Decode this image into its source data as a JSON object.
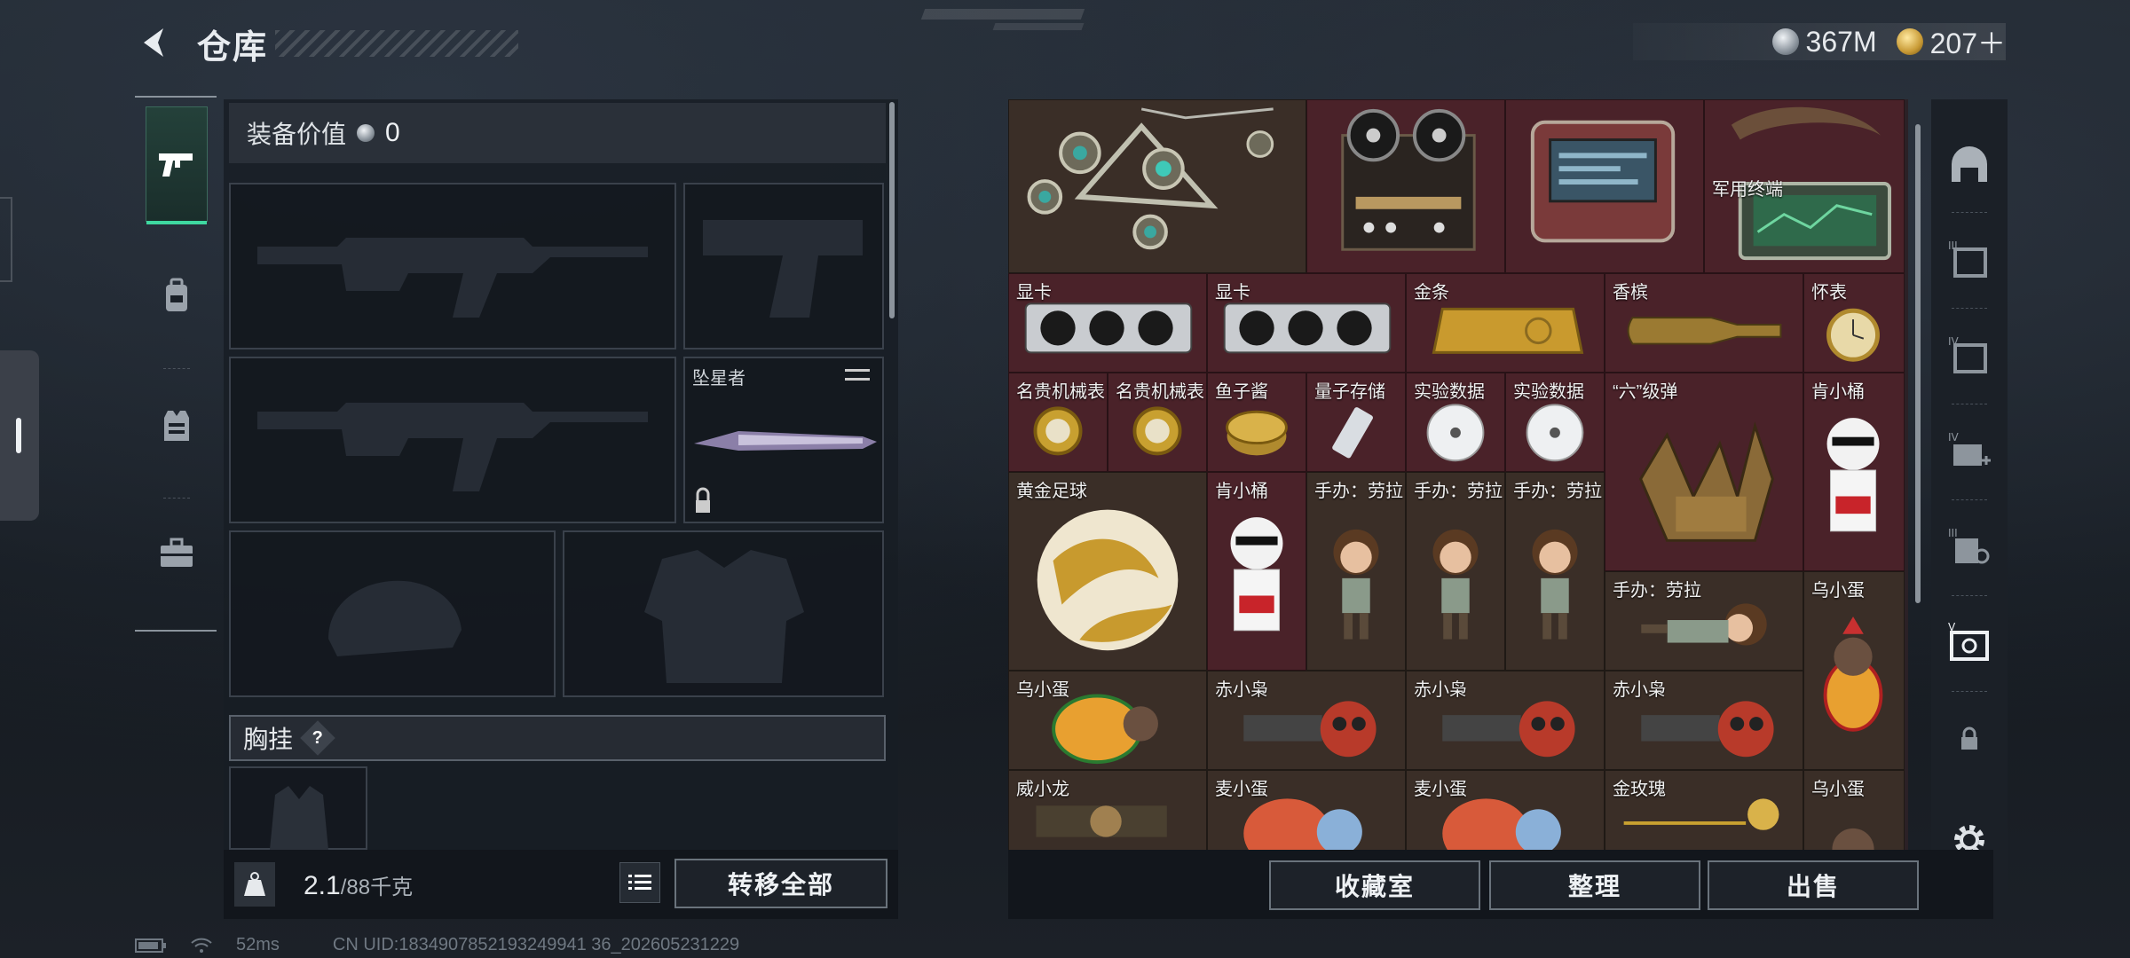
{
  "header": {
    "title": "仓库",
    "currency": [
      {
        "icon": "silver-coin-icon",
        "value": "367M"
      },
      {
        "icon": "gold-coin-icon",
        "value": "207＋"
      }
    ]
  },
  "left_tabs": [
    "pistol-icon",
    "backpack-icon",
    "vest-icon",
    "toolbox-icon"
  ],
  "equipment": {
    "value_label": "装备价值",
    "value": "0",
    "melee_label": "坠星者",
    "chest_label": "胸挂",
    "chest_help": "?",
    "weight": "2.1",
    "weight_max": "/88千克",
    "transfer_all": "转移全部"
  },
  "items": {
    "r2": [
      "显卡",
      "显卡",
      "金条",
      "香槟",
      "怀表"
    ],
    "r3": [
      "名贵机械表",
      "名贵机械表",
      "鱼子酱",
      "量子存储",
      "实验数据",
      "实验数据",
      "“六”级弹",
      "肯小桶"
    ],
    "r4": [
      "黄金足球",
      "肯小桶",
      "手办：劳拉",
      "手办：劳拉",
      "手办：劳拉"
    ],
    "r5": [
      "手办：劳拉",
      "乌小蛋"
    ],
    "r6": [
      "乌小蛋",
      "赤小枭",
      "赤小枭",
      "赤小枭"
    ],
    "r7": [
      "威小龙",
      "麦小蛋",
      "麦小蛋",
      "金玫瑰",
      "乌小蛋"
    ],
    "military": "军用终端"
  },
  "actions": {
    "collection": "收藏室",
    "sort": "整理",
    "sell": "出售"
  },
  "right_tools": [
    "home-icon",
    "tier3-case-icon",
    "tier4-case-icon",
    "tier4-medkit-icon",
    "tier3-armor-icon",
    "vip-case-icon",
    "lock-icon",
    "settings-icon"
  ],
  "status": {
    "ping": "52ms",
    "uid": "CN UID:1834907852193249941 36_202605231229"
  },
  "colors": {
    "accent": "#3fd8a0",
    "rare_cell": "#4a2229",
    "common_cell": "#3a2e27"
  }
}
